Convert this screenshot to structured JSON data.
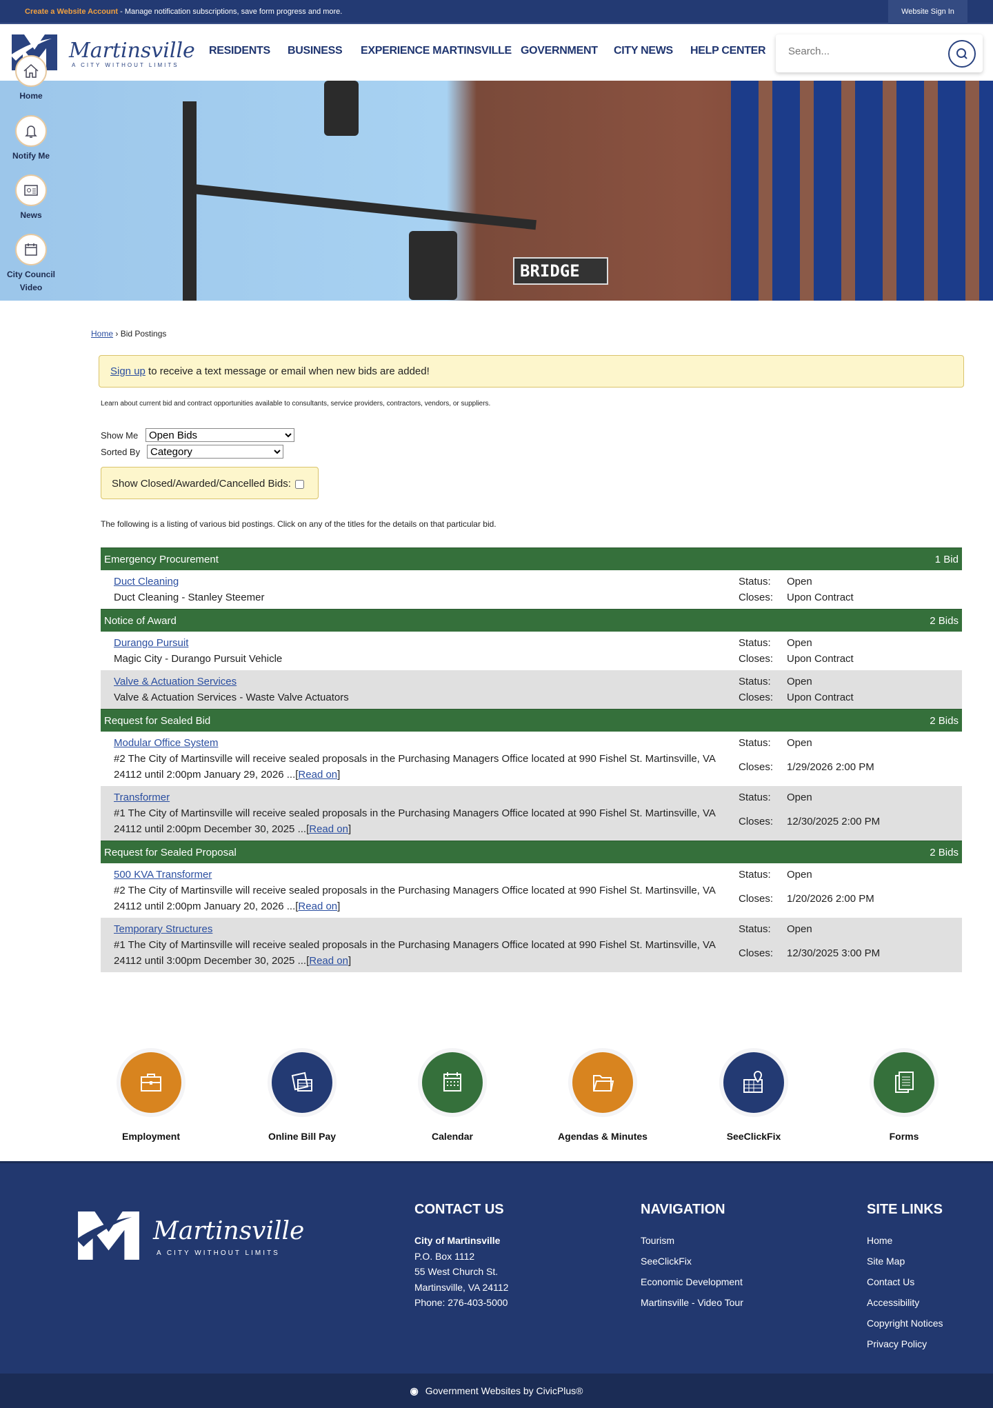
{
  "topbar": {
    "create_account": "Create a Website Account",
    "message": " - Manage notification subscriptions, save form progress and more.",
    "sign_in": "Website Sign In"
  },
  "logo": {
    "name": "Martinsville",
    "tagline": "A CITY WITHOUT LIMITS"
  },
  "nav": [
    "RESIDENTS",
    "BUSINESS",
    "EXPERIENCE MARTINSVILLE",
    "GOVERNMENT",
    "CITY NEWS",
    "HELP CENTER"
  ],
  "search": {
    "placeholder": "Search..."
  },
  "quicknav": [
    {
      "label": "Home",
      "icon": "home-icon"
    },
    {
      "label": "Notify Me",
      "icon": "bell-icon"
    },
    {
      "label": "News",
      "icon": "newspaper-icon"
    },
    {
      "label": "City Council Video",
      "icon": "calendar-icon"
    }
  ],
  "breadcrumb": {
    "home": "Home",
    "sep": " › ",
    "current": "Bid Postings"
  },
  "signup": {
    "link": "Sign up",
    "text": " to receive a text message or email when new bids are added!"
  },
  "description": "Learn about current bid and contract opportunities available to consultants, service providers, contractors, vendors, or suppliers.",
  "filters": {
    "show_me_label": "Show Me",
    "show_me_value": "Open Bids",
    "sorted_by_label": "Sorted By",
    "sorted_by_value": "Category",
    "closed_label": "Show Closed/Awarded/Cancelled Bids:"
  },
  "listing_intro": "The following is a listing of various bid postings. Click on any of the titles for the details on that particular bid.",
  "labels": {
    "status": "Status:",
    "closes": "Closes:",
    "read_on": "Read on"
  },
  "categories": [
    {
      "name": "Emergency Procurement",
      "count": "1 Bid",
      "bids": [
        {
          "title": "Duct Cleaning",
          "desc": "Duct Cleaning - Stanley Steemer",
          "status": "Open",
          "closes": "Upon Contract"
        }
      ]
    },
    {
      "name": "Notice of Award",
      "count": "2 Bids",
      "bids": [
        {
          "title": "Durango Pursuit",
          "desc": "Magic City - Durango Pursuit Vehicle",
          "status": "Open",
          "closes": "Upon Contract"
        },
        {
          "title": "Valve & Actuation Services",
          "desc": "Valve & Actuation Services - Waste Valve Actuators",
          "status": "Open",
          "closes": "Upon Contract"
        }
      ]
    },
    {
      "name": "Request for Sealed Bid",
      "count": "2 Bids",
      "bids": [
        {
          "title": "Modular Office System",
          "desc": "#2 The City of Martinsville will receive sealed proposals in the Purchasing Managers Office located at 990 Fishel St. Martinsville, VA 24112 until 2:00pm January 29, 2026 ...",
          "readon": true,
          "status": "Open",
          "closes": "1/29/2026 2:00 PM"
        },
        {
          "title": "Transformer",
          "desc": "#1 The City of Martinsville will receive sealed proposals in the Purchasing Managers Office located at 990 Fishel St. Martinsville, VA 24112 until 2:00pm December 30, 2025 ...",
          "readon": true,
          "status": "Open",
          "closes": "12/30/2025 2:00 PM"
        }
      ]
    },
    {
      "name": "Request for Sealed Proposal",
      "count": "2 Bids",
      "bids": [
        {
          "title": "500 KVA Transformer",
          "desc": "#2 The City of Martinsville will receive sealed proposals in the Purchasing Managers Office located at 990 Fishel St. Martinsville, VA 24112 until 2:00pm January 20, 2026 ...",
          "readon": true,
          "status": "Open",
          "closes": "1/20/2026 2:00 PM"
        },
        {
          "title": "Temporary Structures",
          "desc": "#1 The City of Martinsville will receive sealed proposals in the Purchasing Managers Office located at 990 Fishel St. Martinsville, VA 24112 until 3:00pm December 30, 2025 ...",
          "readon": true,
          "status": "Open",
          "closes": "12/30/2025 3:00 PM"
        }
      ]
    }
  ],
  "quicklinks": [
    {
      "label": "Employment",
      "color": "#d8841f",
      "icon": "briefcase-icon"
    },
    {
      "label": "Online Bill Pay",
      "color": "#233a73",
      "icon": "credit-card-icon"
    },
    {
      "label": "Calendar",
      "color": "#35703b",
      "icon": "calendar-icon"
    },
    {
      "label": "Agendas & Minutes",
      "color": "#d8841f",
      "icon": "folder-icon"
    },
    {
      "label": "SeeClickFix",
      "color": "#233a73",
      "icon": "map-pin-icon"
    },
    {
      "label": "Forms",
      "color": "#35703b",
      "icon": "documents-icon"
    }
  ],
  "footer": {
    "contact": {
      "heading": "CONTACT US",
      "name": "City of Martinsville",
      "lines": [
        "P.O. Box 1112",
        "55 West Church St.",
        "Martinsville, VA 24112",
        "Phone: 276-403-5000"
      ]
    },
    "navigation": {
      "heading": "NAVIGATION",
      "links": [
        "Tourism",
        "SeeClickFix",
        "Economic Development",
        "Martinsville - Video Tour"
      ]
    },
    "site_links": {
      "heading": "SITE LINKS",
      "links": [
        "Home",
        "Site Map",
        "Contact Us",
        "Accessibility",
        "Copyright Notices",
        "Privacy Policy"
      ]
    },
    "credit": "Government Websites by CivicPlus®"
  }
}
